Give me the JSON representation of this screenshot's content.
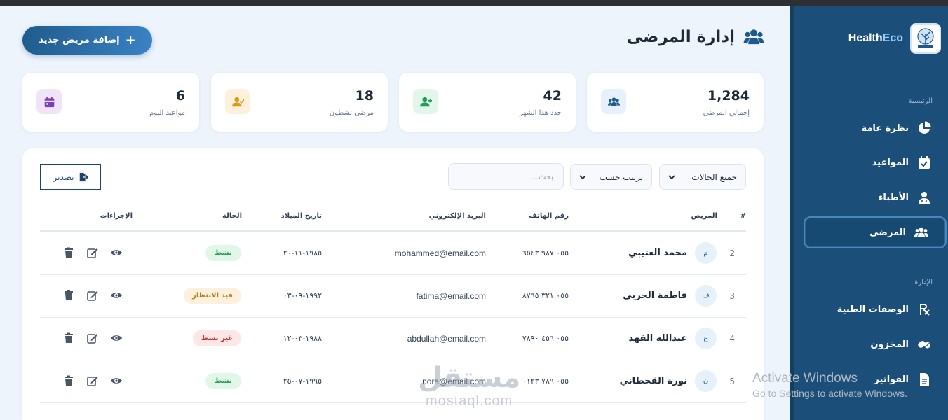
{
  "brand": {
    "part1": "Health",
    "part2": "Eco",
    "logo_text": "HealthEco"
  },
  "sidebar": {
    "section_main": "الرئيسية",
    "section_admin": "الإدارة",
    "items": [
      {
        "label": "نظرة عامة",
        "icon": "pie-chart-icon"
      },
      {
        "label": "المواعيد",
        "icon": "calendar-check-icon"
      },
      {
        "label": "الأطباء",
        "icon": "doctor-icon"
      },
      {
        "label": "المرضى",
        "icon": "users-icon",
        "active": true
      },
      {
        "label": "الوصفات الطبية",
        "icon": "prescription-icon"
      },
      {
        "label": "المخزون",
        "icon": "pills-icon"
      },
      {
        "label": "الفواتير",
        "icon": "invoice-icon"
      }
    ]
  },
  "header": {
    "title": "إدارة المرضى",
    "add_button": "إضافة مريض جديد"
  },
  "stats": [
    {
      "value": "1,284",
      "label": "إجمالي المرضى",
      "icon": "users-icon",
      "color": "#1e5a8c",
      "bg": "#e7f1fb"
    },
    {
      "value": "42",
      "label": "جدد هذا الشهر",
      "icon": "user-plus-icon",
      "color": "#1f9d55",
      "bg": "#e3f6ea"
    },
    {
      "value": "18",
      "label": "مرضى نشطون",
      "icon": "user-check-icon",
      "color": "#d99a1e",
      "bg": "#fdf1dc"
    },
    {
      "value": "6",
      "label": "مواعيد اليوم",
      "icon": "calendar-icon",
      "color": "#7b3fb0",
      "bg": "#efe4f8"
    }
  ],
  "toolbar": {
    "status_filter": "جميع الحالات",
    "sort_by": "ترتيب حسب",
    "search_placeholder": "بحث...",
    "export_label": "تصدير"
  },
  "table": {
    "headers": {
      "index": "#",
      "patient": "المريض",
      "phone": "رقم الهاتف",
      "email": "البريد الإلكتروني",
      "dob": "تاريخ الميلاد",
      "status": "الحالة",
      "actions": "الإجراءات"
    },
    "rows": [
      {
        "index": "2",
        "initial": "م",
        "name": "محمد العتيبي",
        "phone": "٠٥٥ ٩٨٧ ٦٥٤٣",
        "email": "mohammed@email.com",
        "dob": "١٩٨٥-١١-٢٠",
        "status": "نشط",
        "status_color": "#1f9d55",
        "status_bg": "#e3f6ea"
      },
      {
        "index": "3",
        "initial": "ف",
        "name": "فاطمة الحربي",
        "phone": "٠٥٥ ٣٢١ ٨٧٦٥",
        "email": "fatima@email.com",
        "dob": "١٩٩٢-٠٩-٠٣",
        "status": "قيد الانتظار",
        "status_color": "#b7791f",
        "status_bg": "#fdf1dc"
      },
      {
        "index": "4",
        "initial": "ع",
        "name": "عبدالله الفهد",
        "phone": "٠٥٥ ٤٥٦ ٧٨٩٠",
        "email": "abdullah@email.com",
        "dob": "١٩٨٨-٠٣-١٢",
        "status": "غير نشط",
        "status_color": "#c53030",
        "status_bg": "#fde6e6"
      },
      {
        "index": "5",
        "initial": "ن",
        "name": "نورة القحطاني",
        "phone": "٠٥٥ ٧٨٩ ٠١٢٣",
        "email": "nora@email.com",
        "dob": "١٩٩٥-٠٧-٢٥",
        "status": "نشط",
        "status_color": "#1f9d55",
        "status_bg": "#e3f6ea"
      }
    ]
  },
  "overlay": {
    "activate_title": "Activate Windows",
    "activate_sub": "Go to Settings to activate Windows.",
    "mostaql_ar": "مستقل",
    "mostaql_en": "mostaql.com"
  }
}
